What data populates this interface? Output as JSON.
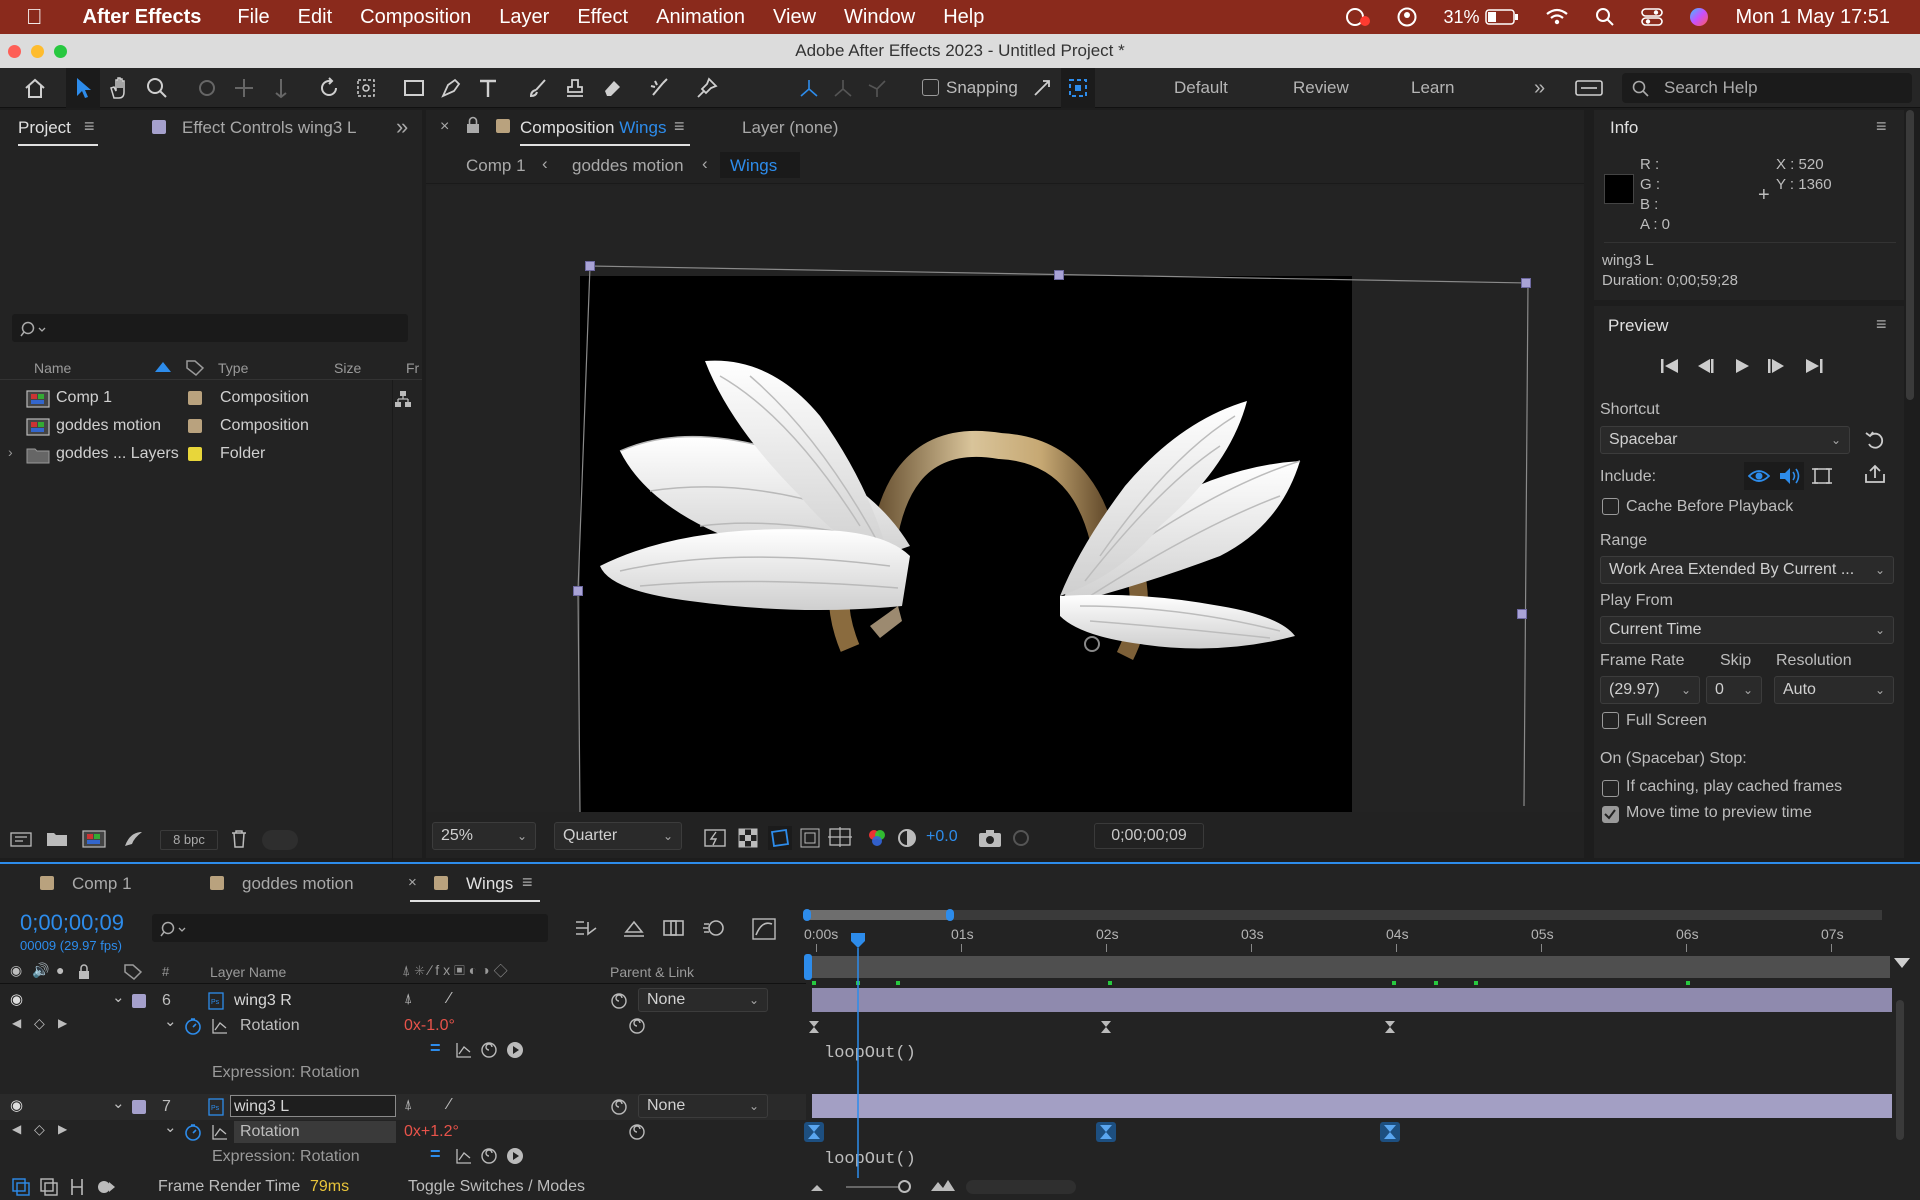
{
  "menubar": {
    "app": "After Effects",
    "items": [
      "File",
      "Edit",
      "Composition",
      "Layer",
      "Effect",
      "Animation",
      "View",
      "Window",
      "Help"
    ],
    "battery": "31%",
    "datetime": "Mon 1 May  17:51"
  },
  "window": {
    "title": "Adobe After Effects 2023 - Untitled Project *"
  },
  "toolbar": {
    "snapping": "Snapping",
    "workspaces": [
      "Default",
      "Review",
      "Learn"
    ],
    "search_placeholder": "Search Help"
  },
  "project": {
    "tab": "Project",
    "effect_controls_tab": "Effect Controls wing3 L",
    "headers": {
      "name": "Name",
      "type": "Type",
      "size": "Size",
      "fr": "Fr"
    },
    "items": [
      {
        "name": "Comp 1",
        "type": "Composition",
        "label_color": "#b9a27e"
      },
      {
        "name": "goddes motion",
        "type": "Composition",
        "label_color": "#b9a27e"
      },
      {
        "name": "goddes ... Layers",
        "type": "Folder",
        "label_color": "#e8d63a"
      }
    ],
    "bpc": "8 bpc"
  },
  "composition": {
    "tab_prefix": "Composition",
    "tab_name": "Wings",
    "layer_tab": "Layer (none)",
    "breadcrumbs": [
      "Comp 1",
      "goddes motion",
      "Wings"
    ],
    "zoom": "25%",
    "resolution": "Quarter",
    "exposure": "+0.0",
    "timecode": "0;00;00;09"
  },
  "info": {
    "title": "Info",
    "r": "R :",
    "g": "G :",
    "b": "B :",
    "a": "A :  0",
    "x": "X :  520",
    "y": "Y :  1360",
    "layer": "wing3 L",
    "duration": "Duration: 0;00;59;28"
  },
  "preview": {
    "title": "Preview",
    "shortcut_label": "Shortcut",
    "shortcut": "Spacebar",
    "include_label": "Include:",
    "cache_before": "Cache Before Playback",
    "range_label": "Range",
    "range": "Work Area Extended By Current ...",
    "play_from_label": "Play From",
    "play_from": "Current Time",
    "frame_rate_label": "Frame Rate",
    "skip_label": "Skip",
    "resolution_label": "Resolution",
    "frame_rate": "(29.97)",
    "skip": "0",
    "resolution": "Auto",
    "full_screen": "Full Screen",
    "stop_label": "On (Spacebar) Stop:",
    "if_caching": "If caching, play cached frames",
    "move_time": "Move time to preview time"
  },
  "timeline": {
    "tabs": [
      {
        "name": "Comp 1",
        "color": "#b9a27e"
      },
      {
        "name": "goddes motion",
        "color": "#b9a27e"
      },
      {
        "name": "Wings",
        "color": "#b9a27e"
      }
    ],
    "timecode": "0;00;00;09",
    "frame_info": "00009 (29.97 fps)",
    "headers": {
      "layer_name": "Layer Name",
      "num": "#",
      "parent": "Parent & Link"
    },
    "ruler": [
      "0:00s",
      "01s",
      "02s",
      "03s",
      "04s",
      "05s",
      "06s",
      "07s"
    ],
    "layers": [
      {
        "num": "6",
        "name": "wing3 R",
        "parent": "None",
        "prop": "Rotation",
        "value_prefix": "0x",
        "value": "-1.0°",
        "expr_label": "Expression: Rotation",
        "expression": "loopOut()"
      },
      {
        "num": "7",
        "name": "wing3 L",
        "parent": "None",
        "prop": "Rotation",
        "value_prefix": "0x",
        "value": "+1.2°",
        "expr_label": "Expression: Rotation",
        "expression": "loopOut()"
      }
    ],
    "footer_render_label": "Frame Render Time",
    "footer_render_value": "79ms",
    "toggle": "Toggle Switches / Modes"
  },
  "colors": {
    "accent": "#2d8ceb",
    "layer_bar": "#8f8aae",
    "value_red": "#e8534a",
    "handle": "#a9a3d6"
  }
}
